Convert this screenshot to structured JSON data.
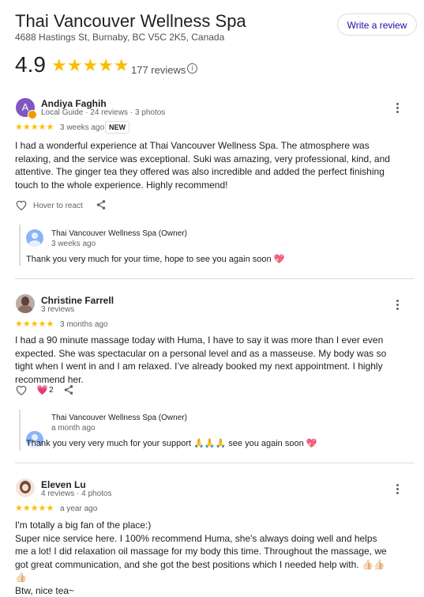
{
  "header": {
    "title": "Thai Vancouver Wellness Spa",
    "address": "4688 Hastings St, Burnaby, BC V5C 2K5, Canada",
    "write_review": "Write a review",
    "rating": "4.9",
    "stars": "★★★★★",
    "review_count": "177 reviews",
    "info_glyph": "i"
  },
  "reviews": [
    {
      "author": "Andiya Faghih",
      "meta": "Local Guide · 24 reviews · 3 photos",
      "avatar_letter": "A",
      "avatar_color": "#7e57c2",
      "stars": "★★★★★",
      "ago": "3 weeks ago",
      "badge": "NEW",
      "text": "I had a wonderful experience at Thai Vancouver Wellness Spa. The atmosphere was relaxing, and the service was exceptional. Suki was amazing, very professional, kind, and attentive. The ginger tea they offered was also incredible and added the perfect finishing touch to the whole experience. Highly recommend!",
      "react_label": "Hover to react",
      "owner": {
        "name": "Thai Vancouver Wellness Spa (Owner)",
        "ago": "3 weeks ago",
        "reply": "Thank you very much for your time, hope to see you again soon 💖"
      }
    },
    {
      "author": "Christine Farrell",
      "meta": "3 reviews",
      "stars": "★★★★★",
      "ago": "3 months ago",
      "text": "I had a 90 minute massage today with Huma, I have to say it was more than I ever even expected. She was spectacular on a personal level and as a masseuse. My body was so tight when I went in and I am relaxed. I’ve already booked my next appointment. I highly recommend her.",
      "reactions": "2",
      "owner": {
        "name": "Thai Vancouver Wellness Spa (Owner)",
        "ago": "a month ago",
        "reply": "Thank you very very much for your support 🙏🙏🙏 see you again soon 💖"
      }
    },
    {
      "author": "Eleven Lu",
      "meta": "4 reviews · 4 photos",
      "stars": "★★★★★",
      "ago": "a year ago",
      "line1": "I'm totally a big fan of the place:)",
      "line2": "Super nice service here. I 100% recommend Huma, she's always doing well and helps me a lot! I did relaxation oil massage for my body this time. Throughout the massage, we got great communication, and she got the best positions which I needed help with. 👍🏻👍🏻👍🏻",
      "line3": "Btw, nice tea~"
    }
  ]
}
